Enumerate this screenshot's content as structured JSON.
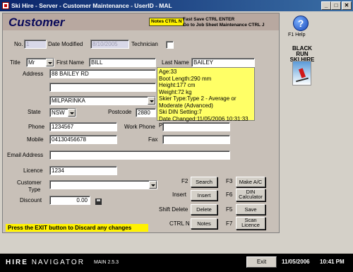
{
  "window": {
    "title": "Ski Hire - Server - Customer Maintenance - UserID - MAL",
    "minimize": "_",
    "maximize": "□",
    "close": "✕"
  },
  "header": {
    "title": "Customer",
    "notes_badge": "Notes CTRL N",
    "hint_line1": "Fast Save CTRL ENTER",
    "hint_line2": "Go to Job Sheet Maintenance CTRL J"
  },
  "form": {
    "no_label": "No.",
    "no_value": "1",
    "date_modified_label": "Date Modified",
    "date_modified_value": "8/10/2005",
    "technician_label": "Technician",
    "title_label": "Title",
    "title_value": "Mr",
    "first_name_label": "First Name",
    "first_name_value": "BILL",
    "last_name_label": "Last Name",
    "last_name_value": "BAILEY",
    "address_label": "Address",
    "address1_value": "88 BAILEY RD",
    "address2_value": "",
    "suburb_value": "MILPARINKA",
    "state_label": "State",
    "state_value": "NSW",
    "postcode_label": "Postcode",
    "postcode_value": "2880",
    "phone_label": "Phone",
    "phone_value": "1234567",
    "work_phone_label": "Work Phone",
    "work_phone_value": "",
    "mobile_label": "Mobile",
    "mobile_value": "04130456678",
    "fax_label": "Fax",
    "fax_value": "",
    "email_label": "Email Address",
    "email_value": "",
    "licence_label": "Licence",
    "licence_value": "1234",
    "customer_type_label_1": "Customer",
    "customer_type_label_2": "Type",
    "customer_type_value": "",
    "discount_label": "Discount",
    "discount_value": "0.00"
  },
  "info": {
    "line1": "Age:33",
    "line2": "Boot Length:290 mm",
    "line3": "Height:177 cm",
    "line4": "Weight:72 kg",
    "line5": "Skier Type:Type 2 - Average or Moderate (Advanced)",
    "line6": "Ski DIN Setting:7",
    "line7": "Date Changed:11/05/2006 10:31:33 PM"
  },
  "shortcuts": {
    "search_key": "F2",
    "search_label": "Search",
    "insert_key": "Insert",
    "insert_label": "Insert",
    "delete_key": "Shift Delete",
    "delete_label": "Delete",
    "notes_key": "CTRL N",
    "notes_label": "Notes",
    "make_ac_key": "F3",
    "make_ac_label": "Make A/C",
    "din_key": "F6",
    "din_label_1": "DIN",
    "din_label_2": "Calculator",
    "save_key": "F5",
    "save_label": "Save",
    "scan_key": "F7",
    "scan_label_1": "Scan",
    "scan_label_2": "Licence"
  },
  "exit_banner": "Press the EXIT button to Discard any changes",
  "side": {
    "help_glyph": "?",
    "help_label": "F1  Help",
    "brand_line1": "BLACK RUN",
    "brand_line2": "SKI HIRE"
  },
  "status": {
    "brand_hire": "HIRE",
    "brand_navigator": "NAVIGATOR",
    "version": "MAIN 2.5.3",
    "exit_label": "Exit",
    "date": "11/05/2006",
    "time": "10:41 PM"
  },
  "colors": {
    "title_bar": "#0a246a",
    "highlight_yellow": "#fff200",
    "info_yellow": "#ffff66",
    "form_bg": "#c8c0b8"
  }
}
